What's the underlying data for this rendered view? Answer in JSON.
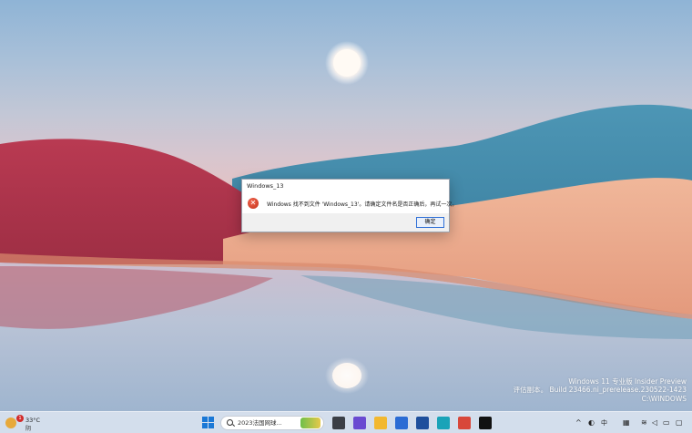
{
  "dialog": {
    "title": "Windows_13",
    "message": "Windows 找不到文件 'Windows_13'。请确定文件名是否正确后，再试一次。",
    "ok_label": "确定"
  },
  "watermark": {
    "line1": "Windows 11 专业版 Insider Preview",
    "line2": "评估副本。 Build 23466.ni_prerelease.230522-1423",
    "line3": "C:\\WINDOWS"
  },
  "taskbar": {
    "weather": {
      "badge": "1",
      "temperature": "33°C",
      "description": "阴"
    },
    "search": {
      "text": "2023法国网球..."
    },
    "apps": [
      {
        "name": "task-view-icon",
        "color": "#3b3f46"
      },
      {
        "name": "meet-icon",
        "color": "#6a4bd1"
      },
      {
        "name": "file-explorer-icon",
        "color": "#f2b82f"
      },
      {
        "name": "store-icon",
        "color": "#2b6cd4"
      },
      {
        "name": "mail-icon",
        "color": "#1e4f9c"
      },
      {
        "name": "edge-icon",
        "color": "#1aa3b8"
      },
      {
        "name": "chrome-icon",
        "color": "#d8473a"
      },
      {
        "name": "penguin-icon",
        "color": "#111111"
      }
    ],
    "tray": {
      "lang": "中",
      "time_hint": ""
    }
  }
}
